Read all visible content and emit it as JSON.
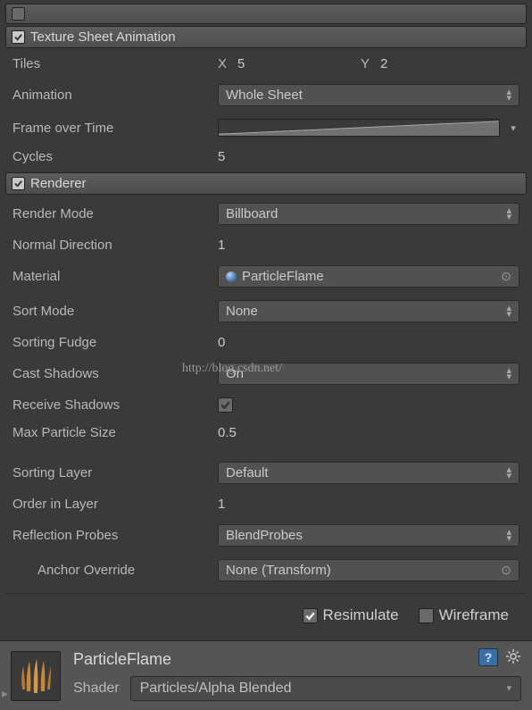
{
  "textureSheet": {
    "title": "Texture Sheet Animation",
    "tiles_label": "Tiles",
    "tiles_x_label": "X",
    "tiles_x": "5",
    "tiles_y_label": "Y",
    "tiles_y": "2",
    "animation_label": "Animation",
    "animation_value": "Whole Sheet",
    "frame_over_time_label": "Frame over Time",
    "cycles_label": "Cycles",
    "cycles_value": "5"
  },
  "renderer": {
    "title": "Renderer",
    "render_mode_label": "Render Mode",
    "render_mode_value": "Billboard",
    "normal_direction_label": "Normal Direction",
    "normal_direction_value": "1",
    "material_label": "Material",
    "material_value": "ParticleFlame",
    "sort_mode_label": "Sort Mode",
    "sort_mode_value": "None",
    "sorting_fudge_label": "Sorting Fudge",
    "sorting_fudge_value": "0",
    "cast_shadows_label": "Cast Shadows",
    "cast_shadows_value": "On",
    "receive_shadows_label": "Receive Shadows",
    "max_particle_size_label": "Max Particle Size",
    "max_particle_size_value": "0.5",
    "sorting_layer_label": "Sorting Layer",
    "sorting_layer_value": "Default",
    "order_in_layer_label": "Order in Layer",
    "order_in_layer_value": "1",
    "reflection_probes_label": "Reflection Probes",
    "reflection_probes_value": "BlendProbes",
    "anchor_override_label": "Anchor Override",
    "anchor_override_value": "None (Transform)"
  },
  "footer": {
    "resimulate_label": "Resimulate",
    "wireframe_label": "Wireframe"
  },
  "material": {
    "name": "ParticleFlame",
    "shader_label": "Shader",
    "shader_value": "Particles/Alpha Blended"
  },
  "watermark": "http://blog.csdn.net/"
}
